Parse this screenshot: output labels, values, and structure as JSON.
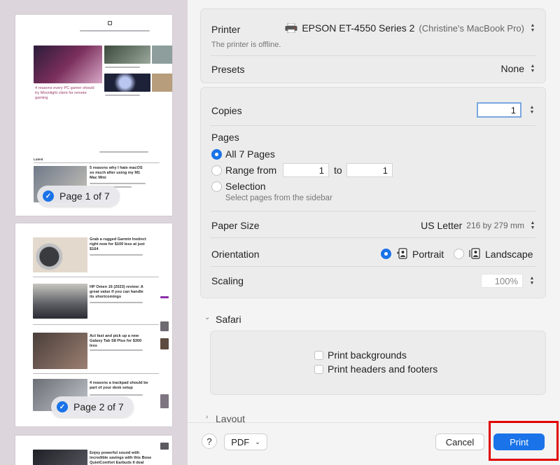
{
  "sidebar": {
    "page1": {
      "headline": "4 reasons every PC gamer should try Moonlight client for remote gaming",
      "section_label": "Latest",
      "article": "5 reasons why I hate macOS so much after using my M1 Mac Mini",
      "pill_label": "Page 1 of 7"
    },
    "page2": {
      "articles": [
        "Grab a rugged Garmin Instinct right now for $100 less at just $164",
        "HP Omen 16 (2023) review: A great value if you can handle its shortcomings",
        "Act fast and pick up a new Galaxy Tab S8 Plus for $300 less",
        "4 reasons a trackpad should be part of your desk setup"
      ],
      "pill_label": "Page 2 of 7"
    },
    "page3": {
      "article": "Enjoy powerful sound with incredible savings with this Bose QuietComfort Earbuds II deal"
    }
  },
  "printer": {
    "label": "Printer",
    "value": "EPSON ET-4550 Series 2",
    "host": "(Christine's MacBook Pro)",
    "status": "The printer is offline."
  },
  "presets": {
    "label": "Presets",
    "value": "None"
  },
  "copies": {
    "label": "Copies",
    "value": "1"
  },
  "pages": {
    "label": "Pages",
    "all": "All 7 Pages",
    "range": "Range from",
    "from": "1",
    "to_label": "to",
    "to": "1",
    "selection": "Selection",
    "selection_hint": "Select pages from the sidebar"
  },
  "paper_size": {
    "label": "Paper Size",
    "value": "US Letter",
    "dims": "216 by 279 mm"
  },
  "orientation": {
    "label": "Orientation",
    "portrait": "Portrait",
    "landscape": "Landscape"
  },
  "scaling": {
    "label": "Scaling",
    "value": "100%"
  },
  "safari": {
    "label": "Safari",
    "print_backgrounds": "Print backgrounds",
    "print_headers": "Print headers and footers"
  },
  "layout": {
    "label": "Layout"
  },
  "footer": {
    "help": "?",
    "pdf": "PDF",
    "cancel": "Cancel",
    "print": "Print"
  },
  "colors": {
    "accent": "#1a73e8",
    "highlight": "#e00000"
  }
}
